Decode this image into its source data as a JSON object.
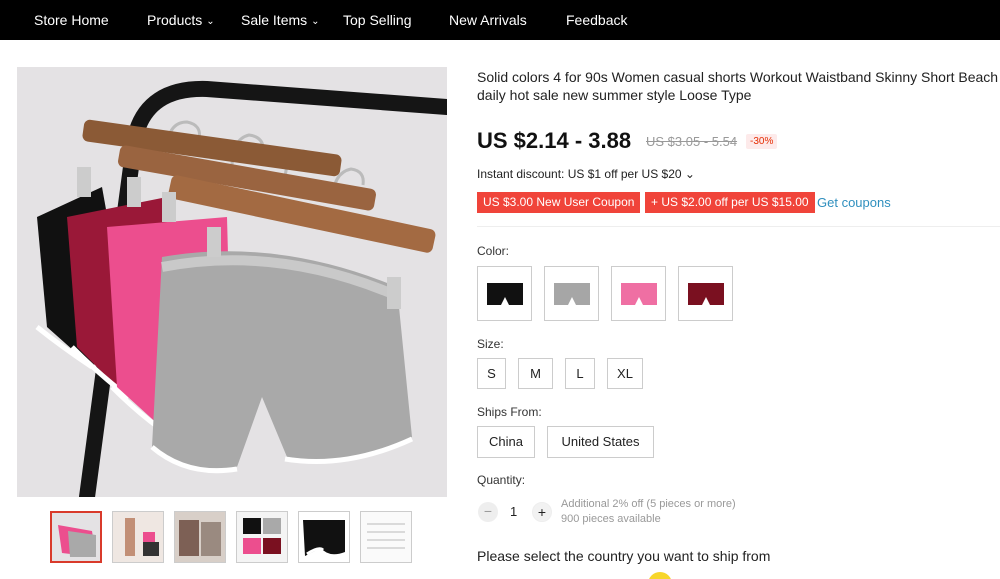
{
  "nav": {
    "items": [
      {
        "label": "Store Home",
        "dropdown": false
      },
      {
        "label": "Products",
        "dropdown": true
      },
      {
        "label": "Sale Items",
        "dropdown": true
      },
      {
        "label": "Top Selling",
        "dropdown": false
      },
      {
        "label": "New Arrivals",
        "dropdown": false
      },
      {
        "label": "Feedback",
        "dropdown": false
      }
    ],
    "chevron": "⌄"
  },
  "product": {
    "title": "Solid colors 4 for 90s Women casual shorts Workout Waistband Skinny Short Beach daily hot sale new summer style Loose Type",
    "price": "US $2.14 - 3.88",
    "old_price": "US $3.05 - 5.54",
    "discount": "-30%",
    "instant_discount": "Instant discount: US $1 off per US $20 ⌄",
    "coupon_new_user": "US $3.00 New User Coupon",
    "coupon_off": "+ US $2.00 off per US $15.00",
    "get_coupons": "Get coupons"
  },
  "color": {
    "label": "Color:",
    "options": [
      {
        "name": "Black",
        "hex": "#111111",
        "trim": "#ffffff"
      },
      {
        "name": "Gray",
        "hex": "#a6a6a6",
        "trim": "#ffffff"
      },
      {
        "name": "Pink",
        "hex": "#ef6fa3",
        "trim": "#ffffff"
      },
      {
        "name": "Wine Red",
        "hex": "#7a1020",
        "trim": "#ffffff"
      }
    ]
  },
  "size": {
    "label": "Size:",
    "options": [
      "S",
      "M",
      "L",
      "XL"
    ]
  },
  "ships_from": {
    "label": "Ships From:",
    "options": [
      "China",
      "United States"
    ]
  },
  "quantity": {
    "label": "Quantity:",
    "value": "1",
    "minus": "−",
    "plus": "+",
    "note1": "Additional 2% off (5 pieces or more)",
    "note2": "900 pieces available"
  },
  "ship_message": "Please select the country you want to ship from",
  "gallery": {
    "thumbnail_count": 6,
    "active_index": 0
  },
  "colors": {
    "nav_bg": "#000000",
    "accent_red": "#f0443a",
    "link_blue": "#2f8fbe"
  }
}
